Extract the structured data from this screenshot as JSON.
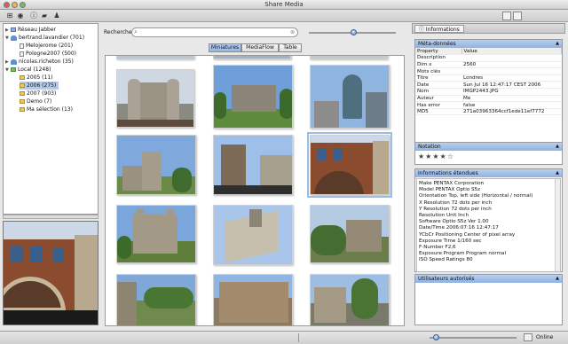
{
  "window": {
    "title": "Share Media"
  },
  "tree": [
    {
      "label": "Réseau Jabber",
      "icon": "network",
      "level": 0,
      "expanded": false
    },
    {
      "label": "bertrand.lavandier (701)",
      "icon": "person",
      "level": 0,
      "expanded": true
    },
    {
      "label": "Melojerome (201)",
      "icon": "doc",
      "level": 1
    },
    {
      "label": "Pologne2007 (500)",
      "icon": "doc",
      "level": 1
    },
    {
      "label": "nicolas.richeton (35)",
      "icon": "person",
      "level": 0,
      "expanded": false
    },
    {
      "label": "Local (1248)",
      "icon": "local",
      "level": 0,
      "expanded": true
    },
    {
      "label": "2005 (11)",
      "icon": "folder",
      "level": 1
    },
    {
      "label": "2006 (275)",
      "icon": "folder",
      "level": 1,
      "selected": true
    },
    {
      "label": "2007 (903)",
      "icon": "folder",
      "level": 1
    },
    {
      "label": "Demo (7)",
      "icon": "folder",
      "level": 1
    },
    {
      "label": "Ma sélection (13)",
      "icon": "folder",
      "level": 1
    }
  ],
  "search": {
    "label": "Recherche"
  },
  "view_tabs": [
    {
      "label": "Miniatures",
      "active": true
    },
    {
      "label": "MediaFlow",
      "active": false
    },
    {
      "label": "Table",
      "active": false
    }
  ],
  "info_panel": {
    "tab_label": "Informations",
    "metadata": {
      "title": "Méta-données",
      "headers": [
        "Property",
        "Value"
      ],
      "rows": [
        [
          "Description",
          ""
        ],
        [
          "Dim x",
          "2560"
        ],
        [
          "Mots clés",
          ""
        ],
        [
          "Titre",
          "Londres"
        ],
        [
          "Date",
          "Sun Jul 16 12:47:17 CEST 2006"
        ],
        [
          "Nom",
          "IMGP2443.JPG"
        ],
        [
          "Auteur",
          "Me"
        ],
        [
          "Has error",
          "false"
        ],
        [
          "MD5",
          "271a03963364ccf1ede11ef7772"
        ]
      ]
    },
    "rating": {
      "title": "Notation",
      "value": 4,
      "max": 5
    },
    "exif": {
      "title": "Informations étendues",
      "lines": [
        "Make PENTAX Corporation",
        "Model PENTAX Optio S5z",
        "Orientation Top, left side (Horizontal / normal)",
        "X Resolution 72 dots per inch",
        "Y Resolution 72 dots per inch",
        "Resolution Unit Inch",
        "Software Optio S5z Ver 1.00",
        "Date/Time 2006:07:16 12:47:17",
        "YCbCr Positioning Center of pixel array",
        "Exposure Time 1/160 sec",
        "F-Number F2,6",
        "Exposure Program Program normal",
        "ISO Speed Ratings 80"
      ]
    },
    "users": {
      "title": "Utilisateurs autorisés"
    }
  },
  "status": {
    "presence": "Online"
  }
}
